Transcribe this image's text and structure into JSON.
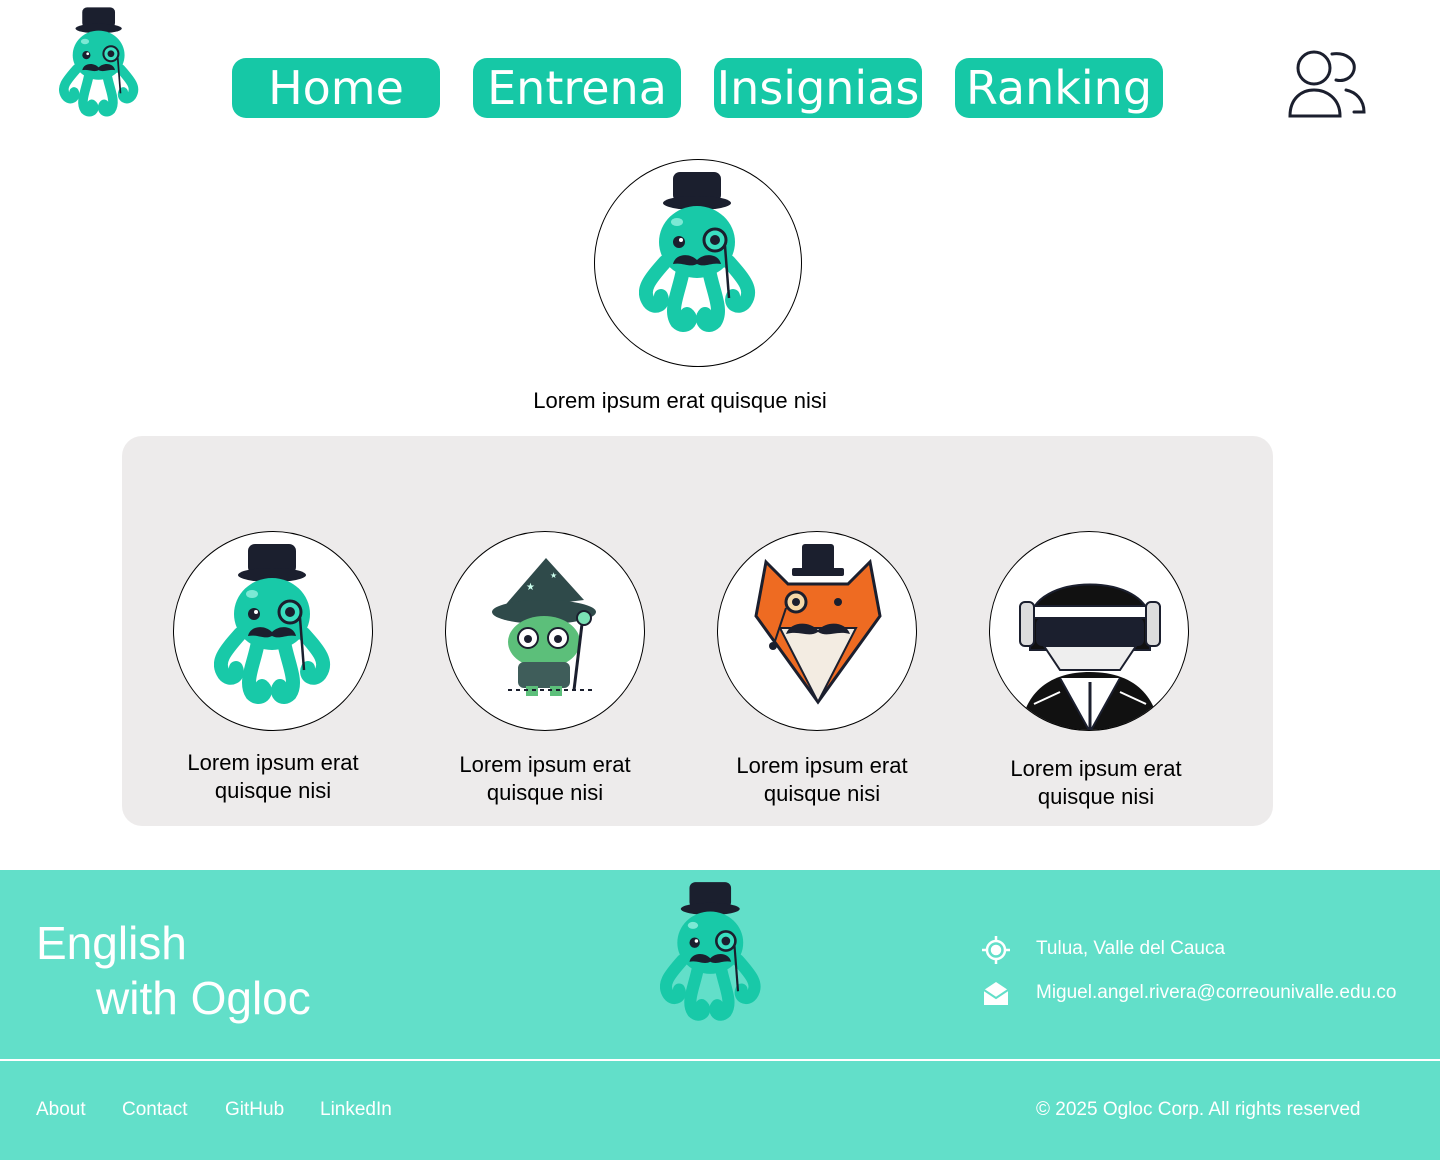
{
  "nav": {
    "home": "Home",
    "entrena": "Entrena",
    "insignias": "Insignias",
    "ranking": "Ranking"
  },
  "profile": {
    "name": "Lorem ipsum erat quisque nisi"
  },
  "badges": [
    {
      "line1": "Lorem ipsum erat",
      "line2": "quisque nisi",
      "icon": "octopus-gentleman"
    },
    {
      "line1": "Lorem ipsum erat",
      "line2": "quisque nisi",
      "icon": "frog-wizard"
    },
    {
      "line1": "Lorem ipsum erat",
      "line2": "quisque nisi",
      "icon": "fox-gentleman"
    },
    {
      "line1": "Lorem ipsum erat",
      "line2": "quisque nisi",
      "icon": "helmet-robot"
    }
  ],
  "footer": {
    "brand_line1": "English",
    "brand_line2": "with Ogloc",
    "location": "Tulua, Valle del Cauca",
    "email": "Miguel.angel.rivera@correounivalle.edu.co",
    "links": [
      "About",
      "Contact",
      "GitHub",
      "LinkedIn"
    ],
    "copyright": "© 2025 Ogloc Corp. All rights reserved"
  },
  "colors": {
    "accent": "#16c8a6",
    "footer_bg": "#62dfc9",
    "panel_bg": "#edebeb"
  }
}
